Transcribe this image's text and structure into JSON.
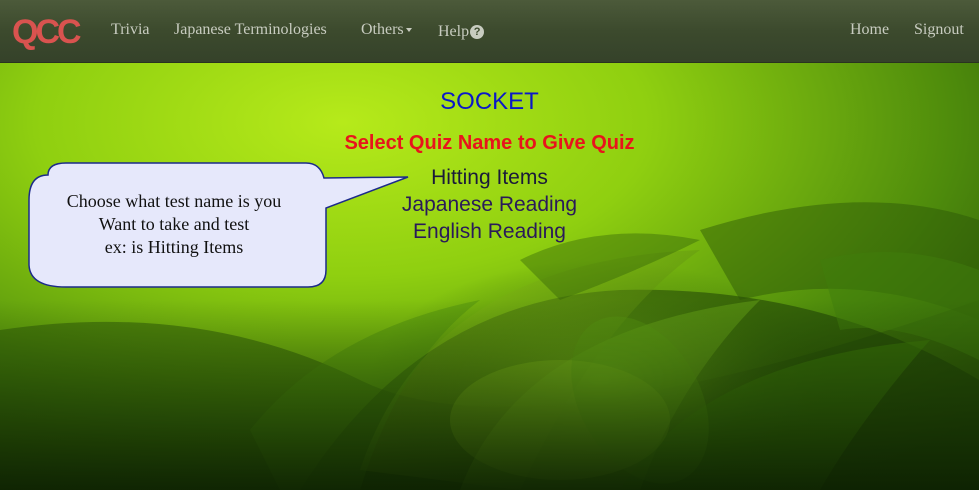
{
  "navbar": {
    "logo_text": "QCC",
    "items": [
      {
        "label": "Trivia"
      },
      {
        "label": "Japanese Terminologies"
      },
      {
        "label": "Others",
        "has_dropdown": true
      },
      {
        "label": "Help",
        "icon": "question-circle-icon"
      }
    ],
    "right_items": [
      {
        "label": "Home"
      },
      {
        "label": "Signout"
      }
    ]
  },
  "content": {
    "section_title": "SOCKET",
    "heading": "Select Quiz Name to Give Quiz",
    "quizzes": [
      {
        "label": "Hitting Items"
      },
      {
        "label": "Japanese Reading"
      },
      {
        "label": "English Reading"
      }
    ]
  },
  "callout": {
    "lines": [
      "Choose what test name is you",
      "Want to take and test",
      "ex: is Hitting Items"
    ]
  },
  "colors": {
    "navbar_bg": "#3c4a2d",
    "nav_text": "#c8ccc0",
    "title_blue": "#0b18c8",
    "heading_red": "#e8141c",
    "quiz_text": "#2a1a5a",
    "callout_fill": "#e6e8fb",
    "background_green": "#8fcf10"
  }
}
